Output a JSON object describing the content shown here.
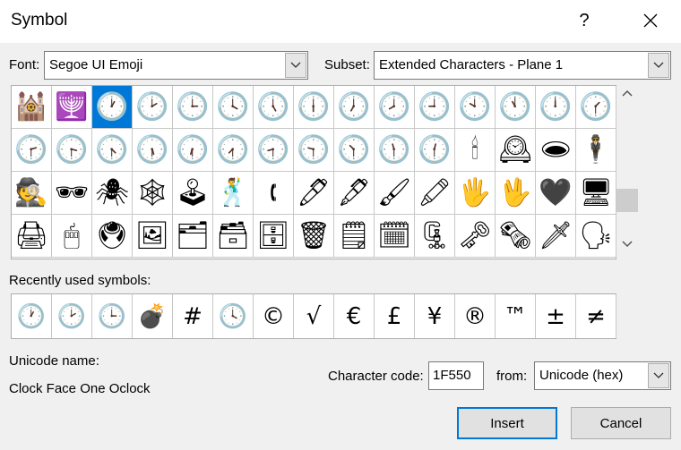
{
  "window": {
    "title": "Symbol",
    "help_label": "?",
    "close_icon": "close-x"
  },
  "font": {
    "label": "Font:",
    "value": "Segoe UI Emoji"
  },
  "subset": {
    "label": "Subset:",
    "value": "Extended Characters - Plane 1"
  },
  "grid": {
    "selected_index": 2,
    "symbols": [
      "🕍",
      "🕎",
      "🕐",
      "🕑",
      "🕒",
      "🕓",
      "🕔",
      "🕕",
      "🕖",
      "🕗",
      "🕘",
      "🕙",
      "🕚",
      "🕛",
      "🕜",
      "🕝",
      "🕞",
      "🕟",
      "🕠",
      "🕡",
      "🕢",
      "🕣",
      "🕤",
      "🕥",
      "🕦",
      "🕧",
      "🕯",
      "🕰",
      "🕳",
      "🕴",
      "🕵",
      "🕶",
      "🕷",
      "🕸",
      "🕹",
      "🕺",
      "🕻",
      "🖊",
      "🖋",
      "🖌",
      "🖍",
      "🖐",
      "🖖",
      "🖤",
      "🖥",
      "🖨",
      "🖱",
      "🖲",
      "🖼",
      "🗂",
      "🗃",
      "🗄",
      "🗑",
      "🗒",
      "🗓",
      "🗜",
      "🗝",
      "🗞",
      "🗡",
      "🗣"
    ]
  },
  "recent": {
    "label": "Recently used symbols:",
    "symbols": [
      "🕐",
      "🕑",
      "🕒",
      "💣",
      "#",
      "🕓",
      "©",
      "√",
      "€",
      "£",
      "¥",
      "®",
      "™",
      "±",
      "≠"
    ]
  },
  "unicode_name": {
    "label": "Unicode name:",
    "value": "Clock Face One Oclock"
  },
  "char_code": {
    "label": "Character code:",
    "value": "1F550"
  },
  "from": {
    "label": "from:",
    "value": "Unicode (hex)"
  },
  "buttons": {
    "insert": "Insert",
    "cancel": "Cancel"
  },
  "colors": {
    "selection": "#0078d7",
    "window_bg": "#f0f0f0"
  }
}
